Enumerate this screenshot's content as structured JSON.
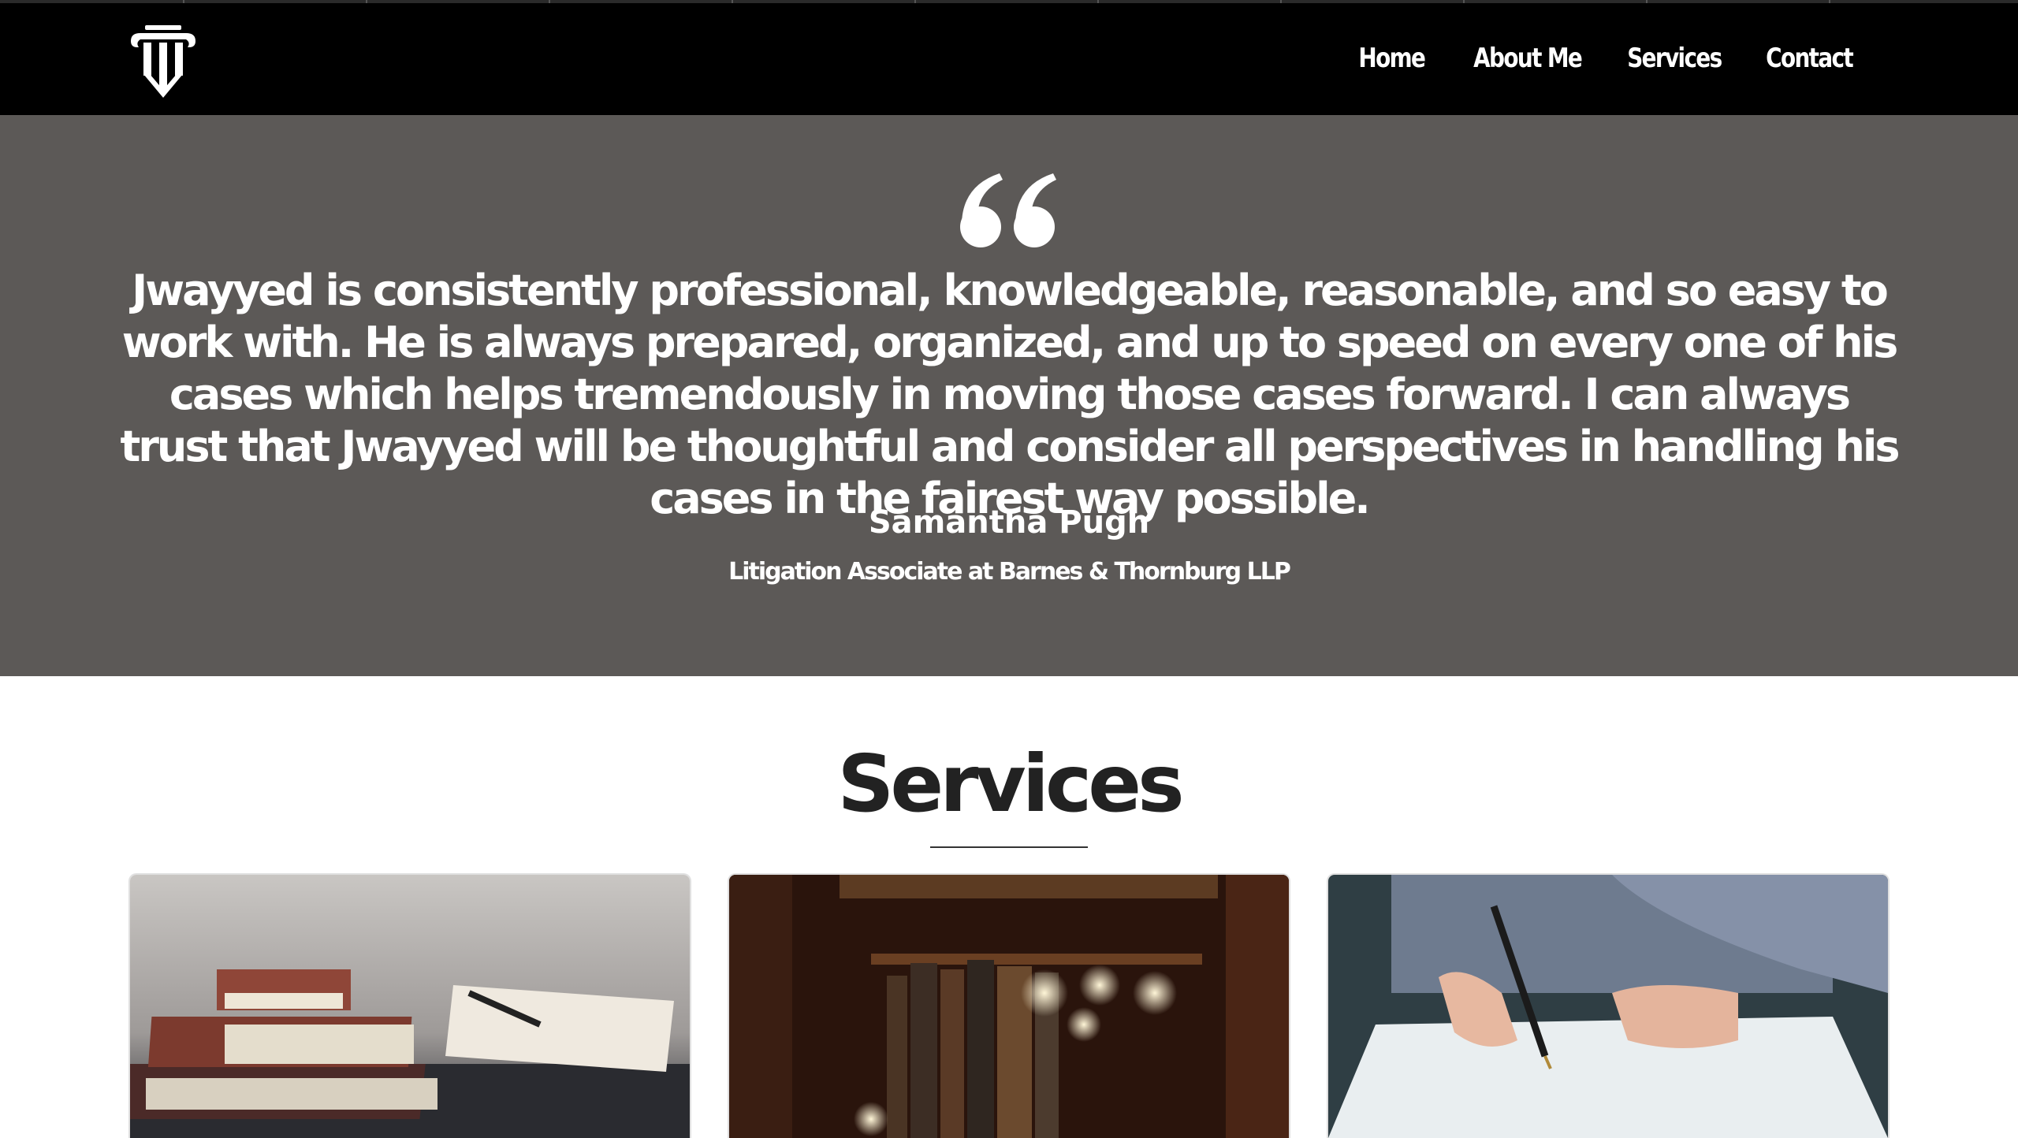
{
  "nav": {
    "logo_icon": "pillar-logo-icon",
    "items": [
      {
        "label": "Home"
      },
      {
        "label": "About Me"
      },
      {
        "label": "Services"
      },
      {
        "label": "Contact"
      }
    ]
  },
  "testimonial": {
    "quote_icon": "quote-icon",
    "text": "Jwayyed is consistently professional, knowledgeable, reasonable, and so easy to work with. He is always prepared, organized, and up to speed on every one of his cases which helps tremendously in moving those cases forward. I can always trust that Jwayyed will be thoughtful and consider all perspectives in handling his cases in the fairest way possible.",
    "author": "Samantha Pugh",
    "author_title": "Litigation Associate at Barnes & Thornburg LLP"
  },
  "services": {
    "heading": "Services",
    "cards": [
      {
        "image": "stacked-books-with-pen-image"
      },
      {
        "image": "bookshelf-image"
      },
      {
        "image": "hand-writing-document-image"
      }
    ]
  },
  "colors": {
    "nav_bg": "#000000",
    "testimonial_bg": "#5c5957",
    "heading_text": "#222222",
    "text_light": "#ffffff"
  }
}
